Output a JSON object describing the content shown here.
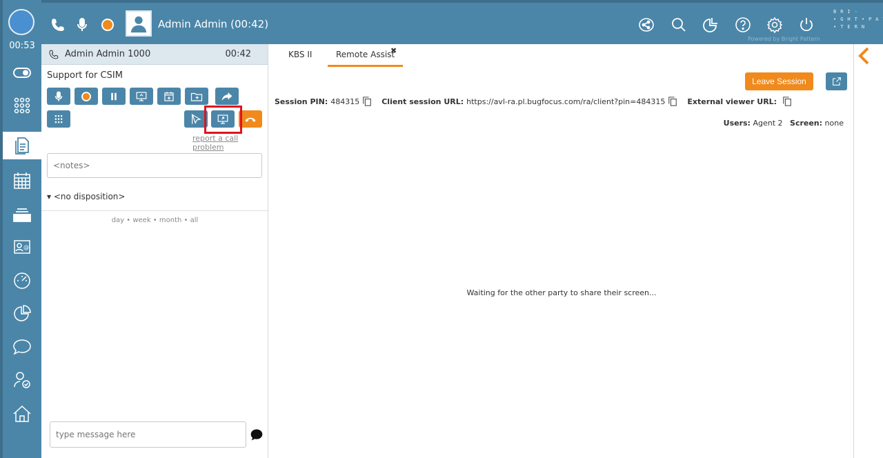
{
  "rail": {
    "timer": "00:53",
    "items": [
      {
        "name": "toggle-icon"
      },
      {
        "name": "grid-icon"
      },
      {
        "name": "document-icon"
      },
      {
        "name": "calendar-icon"
      },
      {
        "name": "inbox-icon"
      },
      {
        "name": "contact-card-icon"
      },
      {
        "name": "dashboard-gauge-icon"
      },
      {
        "name": "pie-chart-icon"
      },
      {
        "name": "chat-bubble-icon"
      },
      {
        "name": "user-check-icon"
      },
      {
        "name": "home-icon"
      }
    ]
  },
  "header": {
    "agent_name": "Admin Admin  (00:42)",
    "brand": "BRI-•GHT•PAT-•TERN",
    "powered_by": "Powered by Bright Pattern"
  },
  "panel": {
    "call_name": "Admin Admin 1000",
    "call_time": "00:42",
    "service": "Support for CSIM",
    "report_link": "report a call problem",
    "notes_placeholder": "<notes>",
    "disposition": "▾ <no disposition>",
    "history_filter": "day • week • month • all",
    "chat_placeholder": "type message here"
  },
  "content": {
    "tabs": [
      "KBS II",
      "Remote Assist"
    ],
    "tab_close": "✖",
    "leave_label": "Leave Session",
    "session": {
      "pin_label": "Session PIN:",
      "pin": "484315",
      "client_label": "Client session URL:",
      "client_url": "https://avl-ra.pl.bugfocus.com/ra/client?pin=484315",
      "viewer_label": "External viewer URL:"
    },
    "users_label": "Users:",
    "users_value": "Agent 2",
    "screen_label": "Screen:",
    "screen_value": "none",
    "waiting": "Waiting for the other party to share their screen..."
  },
  "colors": {
    "brand_blue": "#4b86a8",
    "accent_orange": "#f08a1c",
    "highlight_red": "#e0141e"
  }
}
